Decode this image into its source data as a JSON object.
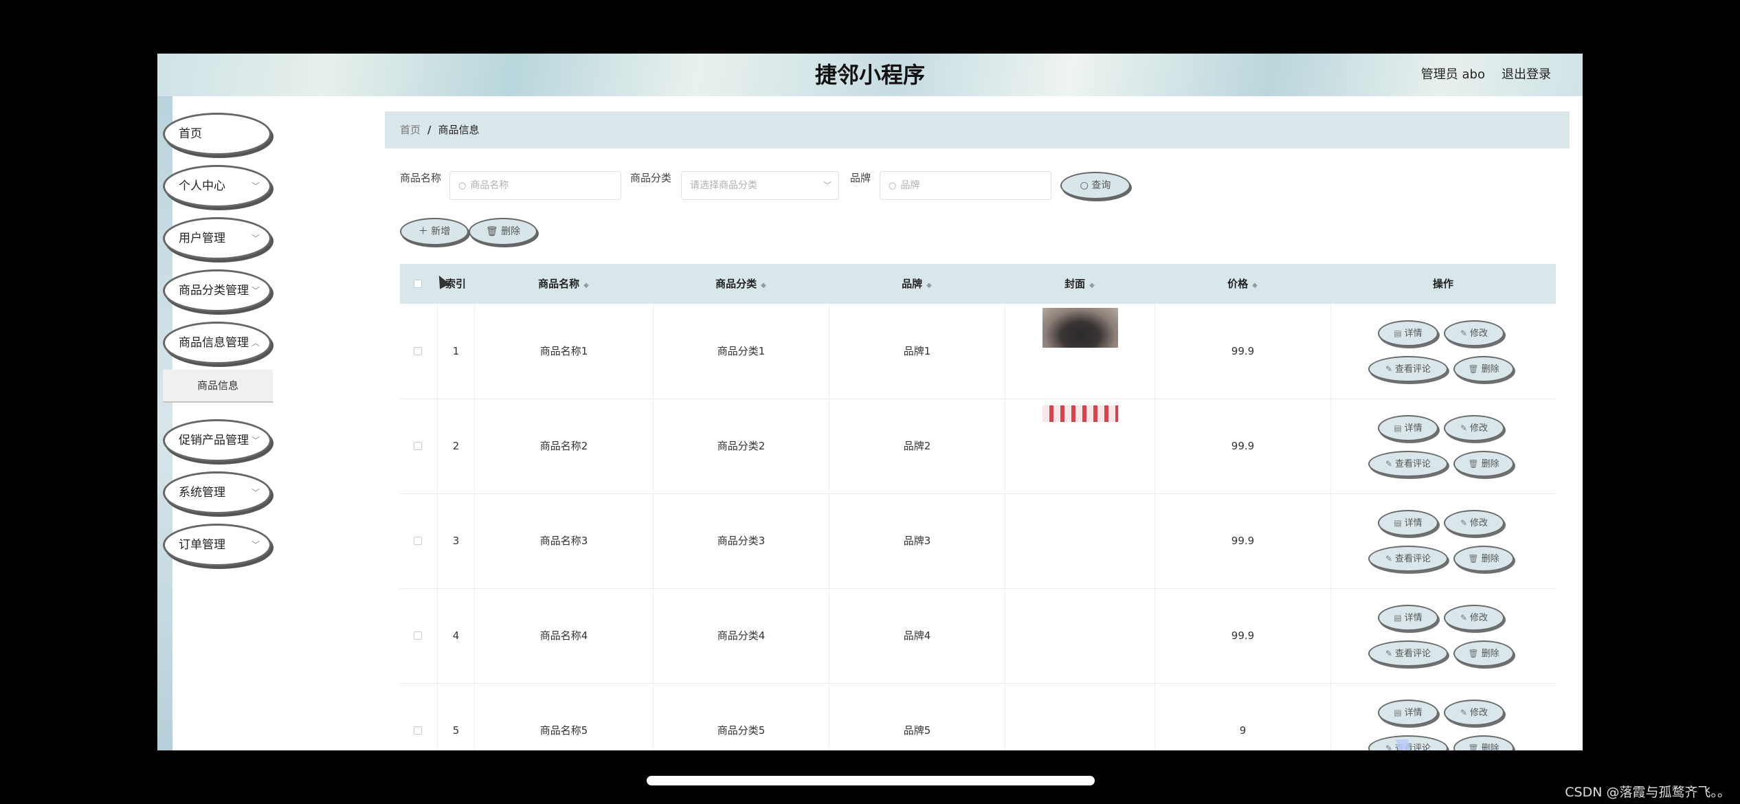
{
  "header": {
    "title": "捷邻小程序",
    "user": "管理员 abo",
    "logout": "退出登录"
  },
  "sidebar": {
    "items": [
      {
        "label": "首页",
        "has_arrow": false
      },
      {
        "label": "个人中心",
        "has_arrow": true
      },
      {
        "label": "用户管理",
        "has_arrow": true
      },
      {
        "label": "商品分类管理",
        "has_arrow": true
      },
      {
        "label": "商品信息管理",
        "has_arrow": true
      },
      {
        "label": "促销产品管理",
        "has_arrow": true
      },
      {
        "label": "系统管理",
        "has_arrow": true
      },
      {
        "label": "订单管理",
        "has_arrow": true
      }
    ],
    "subitem": "商品信息"
  },
  "breadcrumb": {
    "home": "首页",
    "sep": "/",
    "current": "商品信息"
  },
  "filters": {
    "name_label": "商品名称",
    "name_placeholder": "商品名称",
    "category_label": "商品分类",
    "category_placeholder": "请选择商品分类",
    "brand_label": "品牌",
    "brand_placeholder": "品牌",
    "search_button": "查询"
  },
  "toolbar": {
    "add": "新增",
    "delete": "删除"
  },
  "table": {
    "columns": [
      "索引",
      "商品名称",
      "商品分类",
      "品牌",
      "封面",
      "价格",
      "操作"
    ],
    "rows": [
      {
        "index": "1",
        "name": "商品名称1",
        "category": "商品分类1",
        "brand": "品牌1",
        "price": "99.9",
        "cover": "bag"
      },
      {
        "index": "2",
        "name": "商品名称2",
        "category": "商品分类2",
        "brand": "品牌2",
        "price": "99.9",
        "cover": "lipstick"
      },
      {
        "index": "3",
        "name": "商品名称3",
        "category": "商品分类3",
        "brand": "品牌3",
        "price": "99.9",
        "cover": "none"
      },
      {
        "index": "4",
        "name": "商品名称4",
        "category": "商品分类4",
        "brand": "品牌4",
        "price": "99.9",
        "cover": "none"
      },
      {
        "index": "5",
        "name": "商品名称5",
        "category": "商品分类5",
        "brand": "品牌5",
        "price": "9",
        "cover": "none"
      }
    ],
    "actions": {
      "detail": "详情",
      "edit": "修改",
      "comments": "查看评论",
      "delete": "删除"
    }
  },
  "watermark": "CSDN @落霞与孤鹜齐飞。。"
}
